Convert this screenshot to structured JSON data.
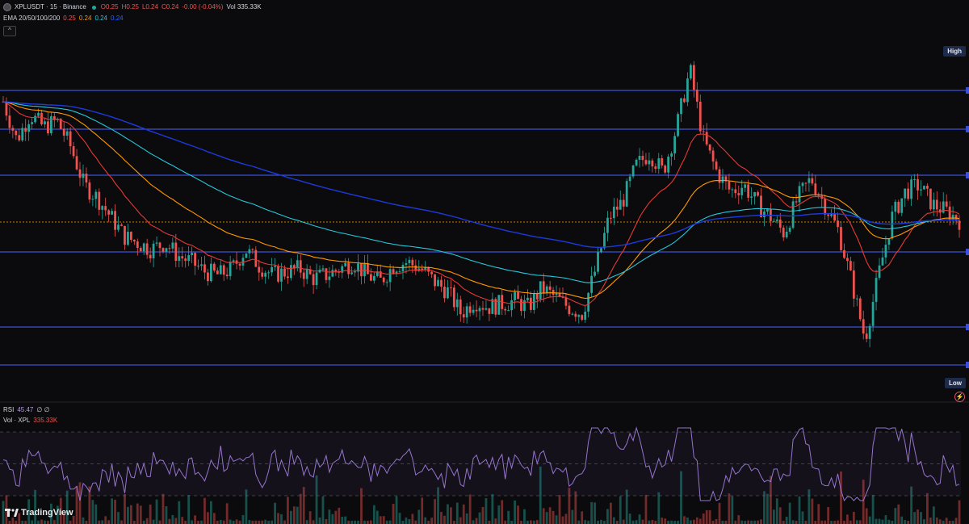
{
  "header": {
    "symbol_line": "XPLUSDT · 15 · Binance",
    "open": "O0.25",
    "high": "H0.25",
    "low": "L0.24",
    "close": "C0.24",
    "change": "-0.00 (-0.04%)",
    "volume": "Vol 335.33K",
    "ema_label": "EMA 20/50/100/200",
    "ema_values": [
      "0.25",
      "0.24",
      "0.24",
      "0.24"
    ],
    "collapse_symbol": "^"
  },
  "price_pane": {
    "high_tag": "High",
    "low_tag": "Low"
  },
  "rsi_pane": {
    "rsi_label": "RSI",
    "rsi_value": "45.47",
    "rsi_extra": "∅ ∅",
    "vol_label": "Vol · XPL",
    "vol_value": "335.33K"
  },
  "branding": {
    "logo_text": "TradingView"
  },
  "colors": {
    "background": "#0b0b0d",
    "bull": "#26a69a",
    "bear": "#ef5350",
    "level_line": "#3b4fd9",
    "ema20": "#e53935",
    "ema50": "#ff9800",
    "ema100": "#26c6da",
    "ema200": "#1e3adb",
    "rsi_line": "#9575cd",
    "current_price_line": "#ff9800"
  },
  "chart_data": {
    "type": "candlestick",
    "symbol": "XPLUSDT",
    "timeframe": "15",
    "exchange": "Binance",
    "indicators": [
      "EMA 20",
      "EMA 50",
      "EMA 100",
      "EMA 200",
      "RSI",
      "Volume"
    ],
    "y_axis_labels_visible": false,
    "horizontal_levels_count": 6,
    "price_path_relative": [
      0.86,
      0.74,
      0.82,
      0.78,
      0.8,
      0.72,
      0.6,
      0.56,
      0.5,
      0.44,
      0.42,
      0.4,
      0.42,
      0.38,
      0.36,
      0.33,
      0.32,
      0.34,
      0.4,
      0.35,
      0.32,
      0.33,
      0.34,
      0.31,
      0.32,
      0.34,
      0.36,
      0.32,
      0.3,
      0.35,
      0.36,
      0.34,
      0.3,
      0.27,
      0.2,
      0.24,
      0.22,
      0.23,
      0.24,
      0.22,
      0.28,
      0.25,
      0.22,
      0.2,
      0.34,
      0.5,
      0.55,
      0.66,
      0.7,
      0.64,
      0.78,
      0.96,
      0.74,
      0.64,
      0.58,
      0.6,
      0.54,
      0.5,
      0.45,
      0.56,
      0.62,
      0.54,
      0.46,
      0.3,
      0.12,
      0.32,
      0.5,
      0.58,
      0.6,
      0.54,
      0.52,
      0.49
    ]
  }
}
